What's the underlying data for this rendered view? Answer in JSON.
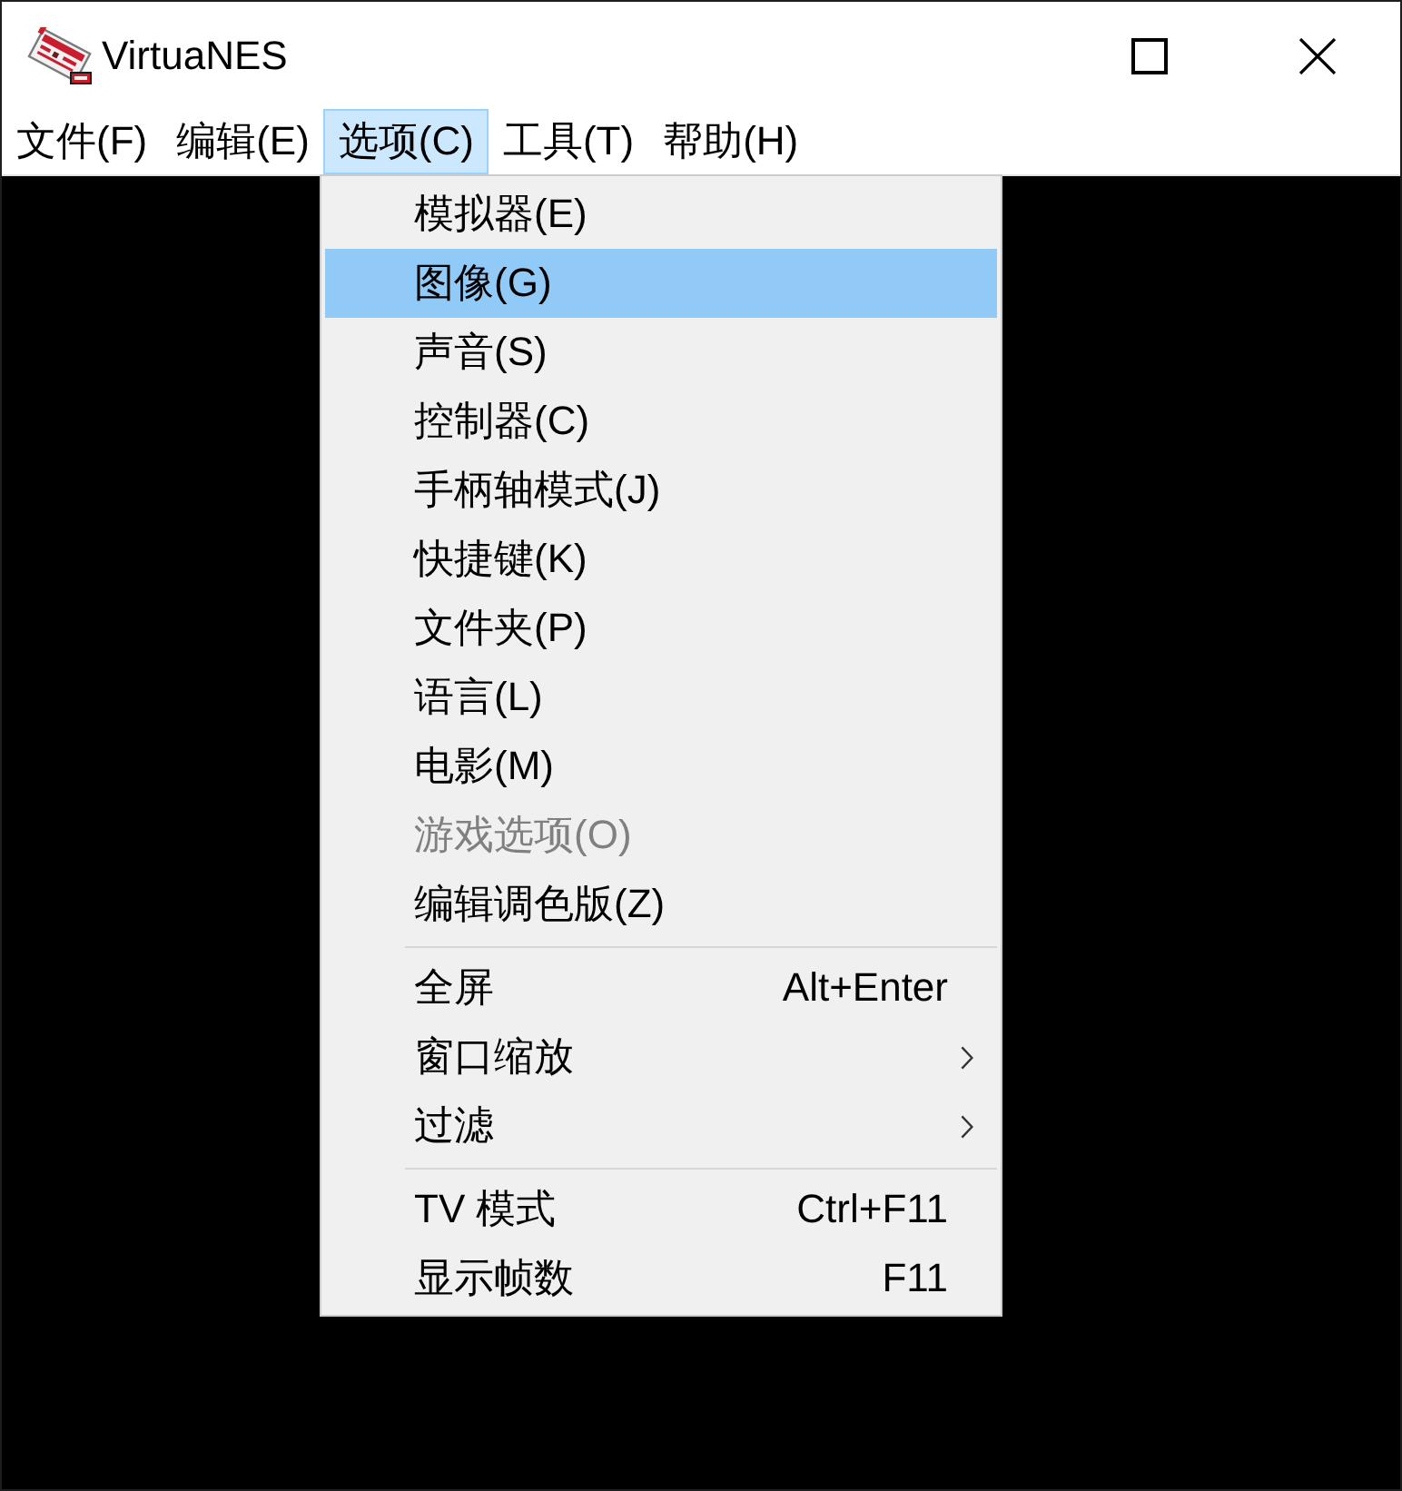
{
  "window": {
    "title": "VirtuaNES"
  },
  "menu_bar": {
    "items": [
      {
        "label": "文件(F)",
        "selected": false
      },
      {
        "label": "编辑(E)",
        "selected": false
      },
      {
        "label": "选项(C)",
        "selected": true
      },
      {
        "label": "工具(T)",
        "selected": false
      },
      {
        "label": "帮助(H)",
        "selected": false
      }
    ]
  },
  "dropdown": {
    "items": [
      {
        "kind": "item",
        "label": "模拟器(E)",
        "selected": false,
        "disabled": false
      },
      {
        "kind": "item",
        "label": "图像(G)",
        "selected": true,
        "disabled": false
      },
      {
        "kind": "item",
        "label": "声音(S)",
        "selected": false,
        "disabled": false
      },
      {
        "kind": "item",
        "label": "控制器(C)",
        "selected": false,
        "disabled": false
      },
      {
        "kind": "item",
        "label": "手柄轴模式(J)",
        "selected": false,
        "disabled": false
      },
      {
        "kind": "item",
        "label": "快捷键(K)",
        "selected": false,
        "disabled": false
      },
      {
        "kind": "item",
        "label": "文件夹(P)",
        "selected": false,
        "disabled": false
      },
      {
        "kind": "item",
        "label": "语言(L)",
        "selected": false,
        "disabled": false
      },
      {
        "kind": "item",
        "label": "电影(M)",
        "selected": false,
        "disabled": false
      },
      {
        "kind": "item",
        "label": "游戏选项(O)",
        "selected": false,
        "disabled": true
      },
      {
        "kind": "item",
        "label": "编辑调色版(Z)",
        "selected": false,
        "disabled": false
      },
      {
        "kind": "separator"
      },
      {
        "kind": "item",
        "label": "全屏",
        "shortcut": "Alt+Enter",
        "selected": false,
        "disabled": false
      },
      {
        "kind": "submenu",
        "label": "窗口缩放",
        "selected": false,
        "disabled": false
      },
      {
        "kind": "submenu",
        "label": "过滤",
        "selected": false,
        "disabled": false
      },
      {
        "kind": "separator"
      },
      {
        "kind": "item",
        "label": "TV 模式",
        "shortcut": "Ctrl+F11",
        "selected": false,
        "disabled": false
      },
      {
        "kind": "item",
        "label": "显示帧数",
        "shortcut": "F11",
        "selected": false,
        "disabled": false
      }
    ]
  }
}
